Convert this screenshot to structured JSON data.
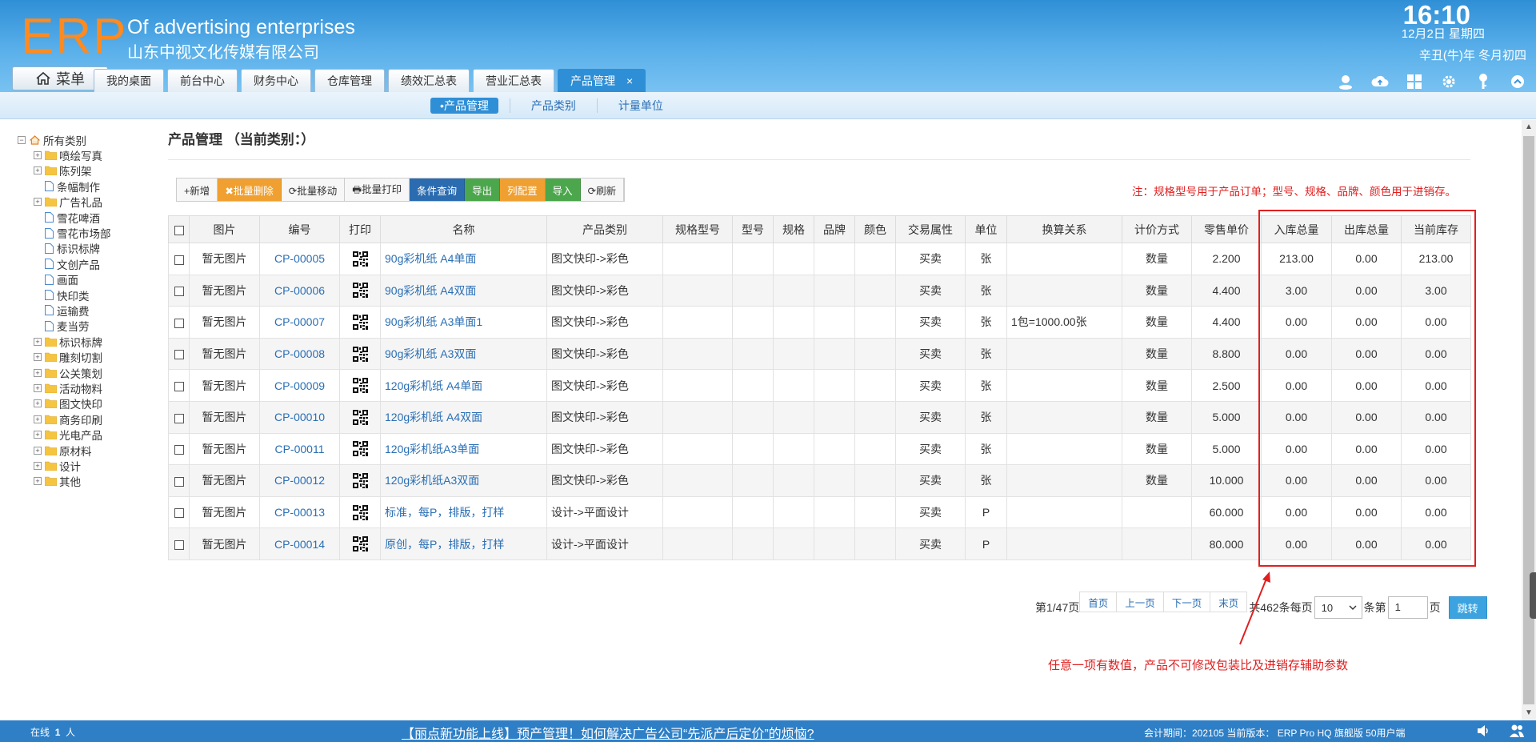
{
  "header": {
    "logo": "ERP",
    "company_en": "Of advertising enterprises",
    "company_cn": "山东中视文化传媒有限公司",
    "time": "16:10",
    "date": "12月2日 星期四",
    "lunar": "辛丑(牛)年 冬月初四",
    "menu_label": "菜单",
    "tabs": [
      {
        "label": "我的桌面"
      },
      {
        "label": "前台中心"
      },
      {
        "label": "财务中心"
      },
      {
        "label": "仓库管理"
      },
      {
        "label": "绩效汇总表"
      },
      {
        "label": "营业汇总表"
      },
      {
        "label": "产品管理",
        "active": true,
        "close": "×"
      }
    ],
    "icons": [
      "user-chat-icon",
      "cloud-upload-icon",
      "apps-grid-icon",
      "gear-icon",
      "key-icon",
      "collapse-up-icon"
    ]
  },
  "subnav": {
    "items": [
      "•产品管理",
      "产品类别",
      "计量单位"
    ]
  },
  "tree": {
    "root": "所有类别",
    "items": [
      {
        "label": "喷绘写真",
        "type": "folder"
      },
      {
        "label": "陈列架",
        "type": "folder"
      },
      {
        "label": "条幅制作",
        "type": "file"
      },
      {
        "label": "广告礼品",
        "type": "folder"
      },
      {
        "label": "雪花啤酒",
        "type": "file"
      },
      {
        "label": "雪花市场部",
        "type": "file"
      },
      {
        "label": "标识标牌",
        "type": "file"
      },
      {
        "label": "文创产品",
        "type": "file"
      },
      {
        "label": "画面",
        "type": "file"
      },
      {
        "label": "快印类",
        "type": "file"
      },
      {
        "label": "运输费",
        "type": "file"
      },
      {
        "label": "麦当劳",
        "type": "file"
      },
      {
        "label": "标识标牌",
        "type": "folder"
      },
      {
        "label": "雕刻切割",
        "type": "folder"
      },
      {
        "label": "公关策划",
        "type": "folder"
      },
      {
        "label": "活动物料",
        "type": "folder"
      },
      {
        "label": "图文快印",
        "type": "folder"
      },
      {
        "label": "商务印刷",
        "type": "folder"
      },
      {
        "label": "光电产品",
        "type": "folder"
      },
      {
        "label": "原材料",
        "type": "folder"
      },
      {
        "label": "设计",
        "type": "folder"
      },
      {
        "label": "其他",
        "type": "folder"
      }
    ]
  },
  "main": {
    "title": "产品管理  （当前类别：）",
    "toolbar": [
      {
        "label": "+新增",
        "style": "plain"
      },
      {
        "label": "✖批量删除",
        "style": "orange"
      },
      {
        "label": "⟳批量移动",
        "style": "plain"
      },
      {
        "label": "🖶批量打印",
        "style": "plain"
      },
      {
        "label": "条件查询",
        "style": "blue"
      },
      {
        "label": "导出",
        "style": "green"
      },
      {
        "label": "列配置",
        "style": "orange"
      },
      {
        "label": "导入",
        "style": "green"
      },
      {
        "label": "⟳刷新",
        "style": "plain"
      }
    ],
    "note": "注：规格型号用于产品订单；型号、规格、品牌、颜色用于进销存。",
    "columns": [
      "图片",
      "编号",
      "打印",
      "名称",
      "产品类别",
      "规格型号",
      "型号",
      "规格",
      "品牌",
      "颜色",
      "交易属性",
      "单位",
      "换算关系",
      "计价方式",
      "零售单价",
      "入库总量",
      "出库总量",
      "当前库存"
    ],
    "rows": [
      {
        "pic": "暂无图片",
        "code": "CP-00005",
        "name": "90g彩机纸 A4单面",
        "cat": "图文快印->彩色",
        "trade": "买卖",
        "unit": "张",
        "conv": "",
        "pricing": "数量",
        "price": "2.200",
        "in": "213.00",
        "out": "0.00",
        "stock": "213.00"
      },
      {
        "pic": "暂无图片",
        "code": "CP-00006",
        "name": "90g彩机纸 A4双面",
        "cat": "图文快印->彩色",
        "trade": "买卖",
        "unit": "张",
        "conv": "",
        "pricing": "数量",
        "price": "4.400",
        "in": "3.00",
        "out": "0.00",
        "stock": "3.00"
      },
      {
        "pic": "暂无图片",
        "code": "CP-00007",
        "name": "90g彩机纸 A3单面1",
        "cat": "图文快印->彩色",
        "trade": "买卖",
        "unit": "张",
        "conv": "1包=1000.00张",
        "pricing": "数量",
        "price": "4.400",
        "in": "0.00",
        "out": "0.00",
        "stock": "0.00"
      },
      {
        "pic": "暂无图片",
        "code": "CP-00008",
        "name": "90g彩机纸 A3双面",
        "cat": "图文快印->彩色",
        "trade": "买卖",
        "unit": "张",
        "conv": "",
        "pricing": "数量",
        "price": "8.800",
        "in": "0.00",
        "out": "0.00",
        "stock": "0.00"
      },
      {
        "pic": "暂无图片",
        "code": "CP-00009",
        "name": "120g彩机纸 A4单面",
        "cat": "图文快印->彩色",
        "trade": "买卖",
        "unit": "张",
        "conv": "",
        "pricing": "数量",
        "price": "2.500",
        "in": "0.00",
        "out": "0.00",
        "stock": "0.00"
      },
      {
        "pic": "暂无图片",
        "code": "CP-00010",
        "name": "120g彩机纸 A4双面",
        "cat": "图文快印->彩色",
        "trade": "买卖",
        "unit": "张",
        "conv": "",
        "pricing": "数量",
        "price": "5.000",
        "in": "0.00",
        "out": "0.00",
        "stock": "0.00"
      },
      {
        "pic": "暂无图片",
        "code": "CP-00011",
        "name": "120g彩机纸A3单面",
        "cat": "图文快印->彩色",
        "trade": "买卖",
        "unit": "张",
        "conv": "",
        "pricing": "数量",
        "price": "5.000",
        "in": "0.00",
        "out": "0.00",
        "stock": "0.00"
      },
      {
        "pic": "暂无图片",
        "code": "CP-00012",
        "name": "120g彩机纸A3双面",
        "cat": "图文快印->彩色",
        "trade": "买卖",
        "unit": "张",
        "conv": "",
        "pricing": "数量",
        "price": "10.000",
        "in": "0.00",
        "out": "0.00",
        "stock": "0.00"
      },
      {
        "pic": "暂无图片",
        "code": "CP-00013",
        "name": "标准，每P，排版，打样",
        "cat": "设计->平面设计",
        "trade": "买卖",
        "unit": "P",
        "conv": "",
        "pricing": "",
        "price": "60.000",
        "in": "0.00",
        "out": "0.00",
        "stock": "0.00"
      },
      {
        "pic": "暂无图片",
        "code": "CP-00014",
        "name": "原创，每P，排版，打样",
        "cat": "设计->平面设计",
        "trade": "买卖",
        "unit": "P",
        "conv": "",
        "pricing": "",
        "price": "80.000",
        "in": "0.00",
        "out": "0.00",
        "stock": "0.00"
      }
    ]
  },
  "pager": {
    "page_info": "第1/47页",
    "first": "首页",
    "prev": "上一页",
    "next": "下一页",
    "last": "末页",
    "total_prefix": "共462条每页",
    "page_size": "10",
    "goto_prefix": "条第",
    "page_input": "1",
    "goto_suffix": "页",
    "go": "跳转"
  },
  "annotation": "任意一项有数值，产品不可修改包装比及进销存辅助参数",
  "footer": {
    "online_label": "在线",
    "online_count": "1",
    "online_unit": "人",
    "news": "【丽点新功能上线】预产管理！如何解决广告公司“先派产后定价”的烦恼?",
    "info": "会计期间：202105 当前版本： ERP Pro HQ 旗舰版 50用户端",
    "icons": [
      "speaker-icon",
      "users-icon"
    ]
  },
  "colors": {
    "header": "#2f8fd6",
    "logo": "#ff8a1f",
    "accent_red": "#e02020",
    "link": "#2a6fb5",
    "footer": "#2e7fc6"
  }
}
